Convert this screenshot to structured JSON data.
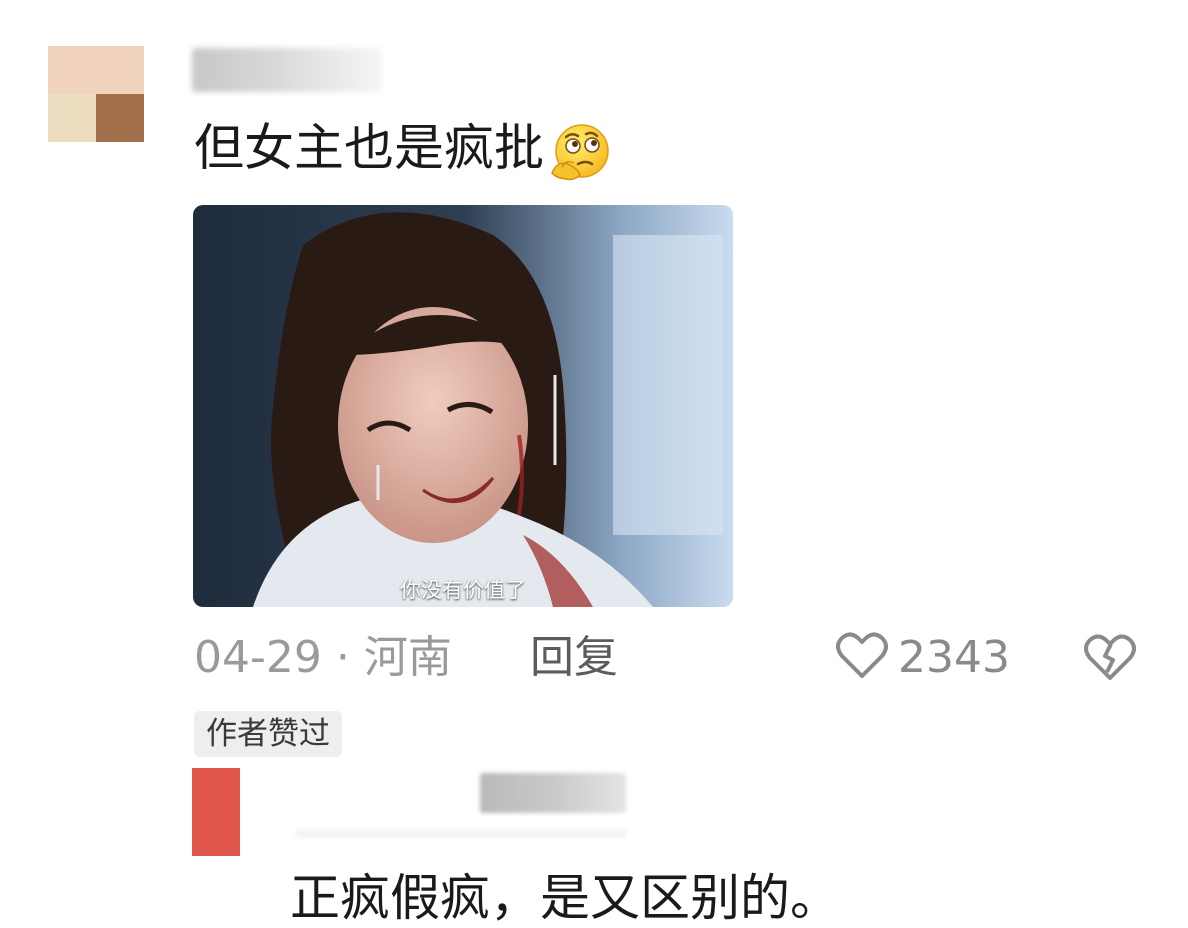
{
  "comment": {
    "text": "但女主也是疯批",
    "emoji": "thinking-face-icon",
    "image_subtitle": "你没有价值了",
    "date": "04-29",
    "separator": "·",
    "location": "河南",
    "reply_label": "回复",
    "like_count": "2343",
    "badge": "作者赞过"
  },
  "reply": {
    "text": "正疯假疯，是又区别的。"
  },
  "colors": {
    "meta_gray": "#9a9a9a",
    "badge_bg": "#eeeeee",
    "reply_avatar": "#e0564b"
  },
  "icons": {
    "like": "heart-outline-icon",
    "dislike": "broken-heart-icon"
  }
}
